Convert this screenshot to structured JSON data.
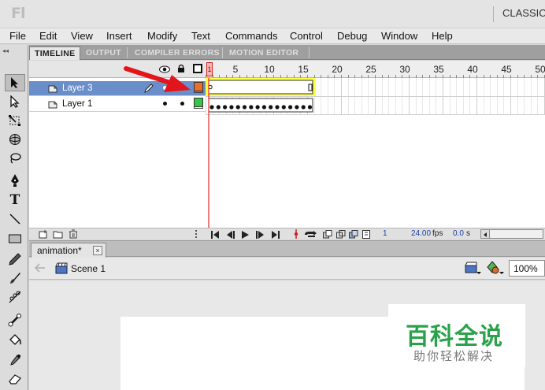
{
  "app": {
    "logo_text": "Fl",
    "workspace_label": "CLASSIC"
  },
  "menu": [
    "File",
    "Edit",
    "View",
    "Insert",
    "Modify",
    "Text",
    "Commands",
    "Control",
    "Debug",
    "Window",
    "Help"
  ],
  "panel_tabs": [
    "TIMELINE",
    "OUTPUT",
    "COMPILER ERRORS",
    "MOTION EDITOR"
  ],
  "active_panel_tab": "TIMELINE",
  "timeline": {
    "frame_numbers": [
      "1",
      "5",
      "10",
      "15",
      "20",
      "25",
      "30",
      "35",
      "40",
      "45",
      "50"
    ],
    "playhead_frame": 1,
    "layers": [
      {
        "name": "Layer 3",
        "selected": true,
        "color": "#e8702a"
      },
      {
        "name": "Layer 1",
        "selected": false,
        "color": "#38c447"
      }
    ],
    "footer": {
      "current_frame": "1",
      "frame_rate": "24.00",
      "fps_unit": "fps",
      "elapsed": "0.0",
      "elapsed_unit": "s"
    }
  },
  "document": {
    "tab_label": "animation*",
    "close_glyph": "×"
  },
  "editbar": {
    "scene_label": "Scene 1",
    "zoom": "100%"
  },
  "watermark": {
    "title": "百科全说",
    "subtitle": "助你轻松解决"
  },
  "colors": {
    "selected_layer": "#6a8ec9",
    "frame_highlight": "#ffff44",
    "playhead": "#e02a2a",
    "arrow": "#e3141b"
  }
}
